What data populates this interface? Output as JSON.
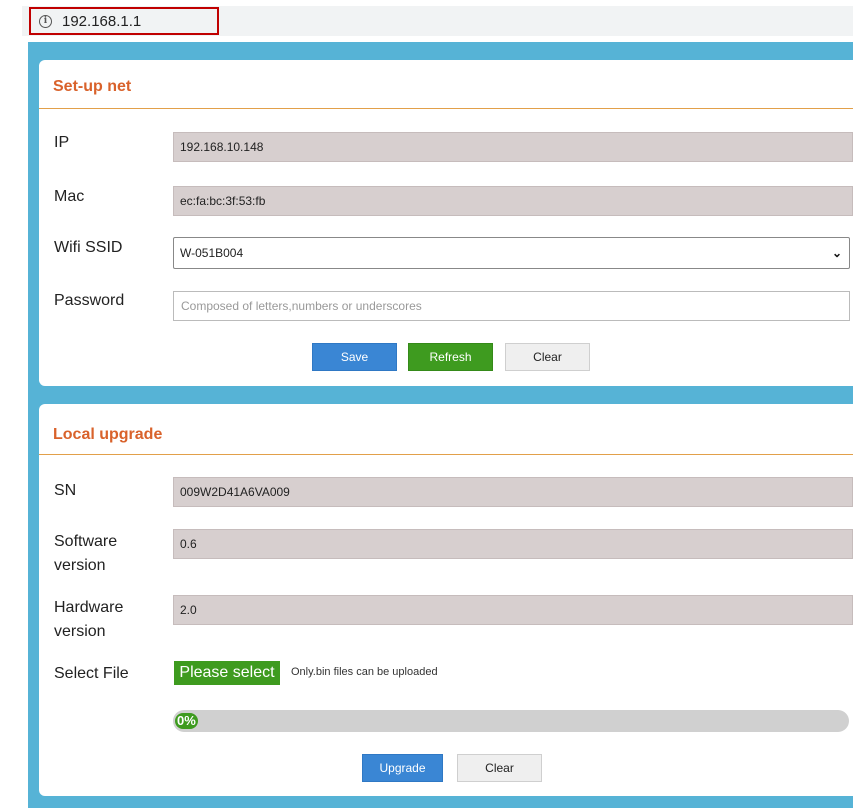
{
  "address_bar": {
    "url": "192.168.1.1",
    "info_icon": "info-icon"
  },
  "setup_net": {
    "title": "Set-up net",
    "ip_label": "IP",
    "ip_value": "192.168.10.148",
    "mac_label": "Mac",
    "mac_value": "ec:fa:bc:3f:53:fb",
    "ssid_label": "Wifi SSID",
    "ssid_selected": "W-051B004",
    "password_label": "Password",
    "password_placeholder": "Composed of letters,numbers or underscores",
    "password_value": "",
    "save_label": "Save",
    "refresh_label": "Refresh",
    "clear_label": "Clear"
  },
  "local_upgrade": {
    "title": "Local upgrade",
    "sn_label": "SN",
    "sn_value": "009W2D41A6VA009",
    "software_label_1": "Software",
    "software_label_2": "version",
    "software_value": "0.6",
    "hardware_label_1": "Hardware",
    "hardware_label_2": "version",
    "hardware_value": "2.0",
    "select_file_label": "Select File",
    "select_button_label": "Please select",
    "file_note": "Only.bin files can be uploaded",
    "progress_text": "0%",
    "progress_fraction": 0,
    "upgrade_label": "Upgrade",
    "clear_label": "Clear"
  },
  "colors": {
    "frame_blue": "#56b3d6",
    "title_orange": "#d9622b",
    "button_blue": "#3a86d4",
    "button_green": "#3e9b1f",
    "readonly_field": "#d7cfcf"
  }
}
